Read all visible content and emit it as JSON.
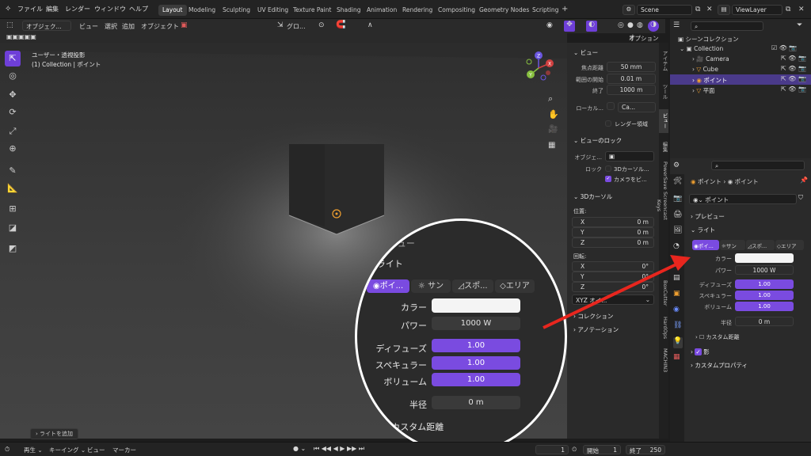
{
  "topbar": {
    "menus": [
      "ファイル",
      "編集",
      "レンダー",
      "ウィンドウ",
      "ヘルプ"
    ],
    "workspaces": [
      "Layout",
      "Modeling",
      "Sculpting",
      "UV Editing",
      "Texture Paint",
      "Shading",
      "Animation",
      "Rendering",
      "Compositing",
      "Geometry Nodes",
      "Scripting"
    ],
    "add_tab": "+",
    "scene": "Scene",
    "view_layer": "ViewLayer"
  },
  "viewport_header": {
    "mode": "オブジェク...",
    "menus": [
      "ビュー",
      "選択",
      "追加",
      "オブジェクト"
    ],
    "orientation": "グロ...",
    "options": "オプション"
  },
  "viewport": {
    "view_name": "ユーザー・透視投影",
    "collection_info": "(1) Collection | ポイント",
    "last_op": "ライトを追加",
    "gizmo": {
      "x": "X",
      "y": "Y",
      "z": "Z"
    }
  },
  "npanel": {
    "view_section": "ビュー",
    "focal_label": "焦点距離",
    "focal_value": "50 mm",
    "clip_start_label": "範囲の開始",
    "clip_start_value": "0.01 m",
    "clip_end_label": "終了",
    "clip_end_value": "1000 m",
    "local_camera": "ローカル...",
    "local_camera_value": "Ca...",
    "render_region": "レンダー領域",
    "view_lock_section": "ビューのロック",
    "lock_object_label": "オブジェ...",
    "lock_label": "ロック",
    "lock_3d_cursor": "3Dカーソル...",
    "lock_camera": "カメラをビ...",
    "cursor_section": "3Dカーソル",
    "location_label": "位置:",
    "loc_x": "X",
    "loc_x_value": "0 m",
    "loc_y": "Y",
    "loc_y_value": "0 m",
    "loc_z": "Z",
    "loc_z_value": "0 m",
    "rotation_label": "回転:",
    "rot_x": "X",
    "rot_x_value": "0°",
    "rot_y": "Y",
    "rot_y_value": "0°",
    "rot_z": "Z",
    "rot_z_value": "0°",
    "rotation_mode": "XYZ オイ...",
    "collection_section": "コレクション",
    "annotation_section": "アノテーション"
  },
  "ntabs": [
    "アイテム",
    "ツール",
    "ビュー",
    "編集",
    "PowerSave",
    "Screencast Keys",
    "BoxCutter",
    "HardOps",
    "MACHIN3"
  ],
  "outliner": {
    "root": "シーンコレクション",
    "collection": "Collection",
    "items": [
      "Camera",
      "Cube",
      "ポイント",
      "平面"
    ]
  },
  "properties": {
    "breadcrumb_object": "ポイント",
    "breadcrumb_data": "ポイント",
    "datablock": "ポイント",
    "preview_section": "プレビュー",
    "light_section": "ライト",
    "light_types": [
      "ポイ...",
      "サン",
      "スポ...",
      "エリア"
    ],
    "color_label": "カラー",
    "power_label": "パワー",
    "power_value": "1000 W",
    "diffuse_label": "ディフューズ",
    "diffuse_value": "1.00",
    "specular_label": "スペキュラー",
    "specular_value": "1.00",
    "volume_label": "ボリューム",
    "volume_value": "1.00",
    "radius_label": "半径",
    "radius_value": "0 m",
    "custom_distance": "カスタム距離",
    "shadow_section": "影",
    "custom_props_section": "カスタムプロパティ"
  },
  "zoom": {
    "preview_section": "ビュー",
    "light_section": "ライト",
    "light_types": [
      "ポイ...",
      "サン",
      "スポ...",
      "エリア"
    ],
    "color_label": "カラー",
    "power_label": "パワー",
    "power_value": "1000 W",
    "diffuse_label": "ディフューズ",
    "diffuse_value": "1.00",
    "specular_label": "スペキュラー",
    "specular_value": "1.00",
    "volume_label": "ボリューム",
    "volume_value": "1.00",
    "radius_label": "半径",
    "radius_value": "0 m",
    "custom_distance": "カスタム距離"
  },
  "timeline": {
    "playback": "再生",
    "keying": "キーイング",
    "view": "ビュー",
    "marker": "マーカー",
    "current_frame": "1",
    "start_label": "開始",
    "start_value": "1",
    "end_label": "終了",
    "end_value": "250"
  },
  "colors": {
    "accent": "#7a4be0",
    "annotation": "#e8261e"
  }
}
